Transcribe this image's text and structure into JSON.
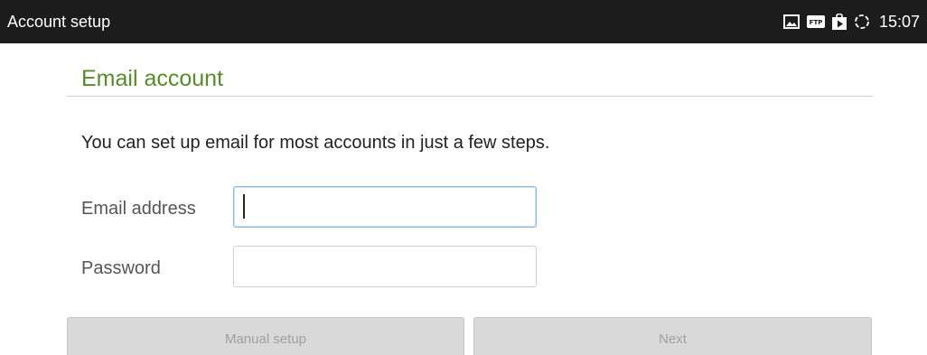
{
  "status_bar": {
    "title": "Account setup",
    "time": "15:07",
    "icons": [
      "image-icon",
      "ftp-icon",
      "play-store-icon",
      "sync-icon"
    ]
  },
  "form": {
    "heading": "Email account",
    "intro": "You can set up email for most accounts in just a few steps.",
    "email_label": "Email address",
    "email_value": "",
    "password_label": "Password",
    "password_value": ""
  },
  "buttons": {
    "manual_setup": "Manual setup",
    "next": "Next"
  },
  "colors": {
    "accent_green": "#5a8a2a",
    "status_bar_bg": "#1c1c1c",
    "focus_border": "#8fb6dd"
  }
}
